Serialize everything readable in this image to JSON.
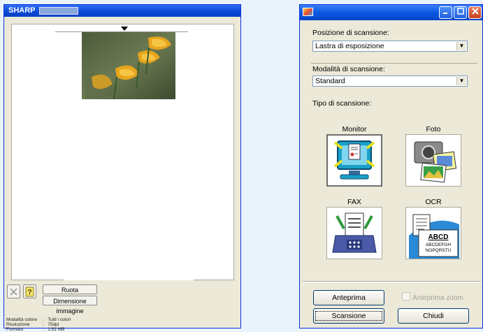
{
  "preview_window": {
    "title": "SHARP",
    "rotate_label": "Ruota",
    "image_size_label": "Dimensione immagine",
    "info": [
      {
        "key": "Modalità colore",
        "value": "Tutti i colori"
      },
      {
        "key": "Risoluzione",
        "value": "75dpi"
      },
      {
        "key": "Formato",
        "value": "1.91 MB"
      }
    ]
  },
  "scan_dialog": {
    "scan_position_label": "Posizione di scansione:",
    "scan_position_value": "Lastra di esposizione",
    "scan_mode_label": "Modalità di scansione:",
    "scan_mode_value": "Standard",
    "scan_type_label": "Tipo di scansione:",
    "scan_types": [
      {
        "label": "Monitor",
        "icon": "monitor-icon"
      },
      {
        "label": "Foto",
        "icon": "camera-photo-icon"
      },
      {
        "label": "FAX",
        "icon": "fax-icon"
      },
      {
        "label": "OCR",
        "icon": "ocr-document-icon"
      }
    ],
    "ocr_sample": [
      "ABCD",
      "ABCDEFGH",
      "NOPQRSTU"
    ],
    "preview_button": "Anteprima",
    "preview_zoom_label": "Anteprima zoom",
    "scan_button": "Scansione",
    "close_button": "Chiudi"
  },
  "colors": {
    "titlebar": "#0a4ad8",
    "dialog_bg": "#ece9d8",
    "desktop": "#e9f3fb"
  }
}
